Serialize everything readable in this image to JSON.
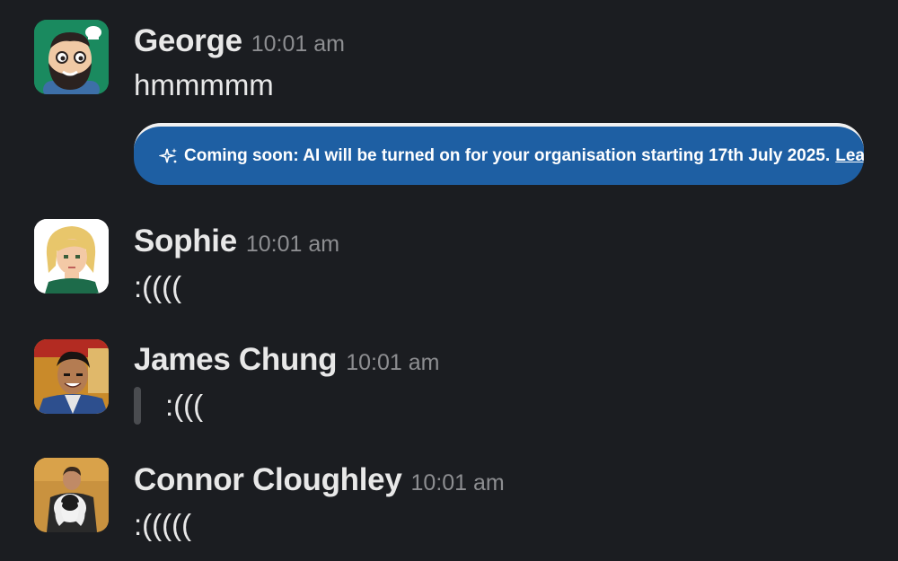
{
  "messages": [
    {
      "sender": "George",
      "time": "10:01 am",
      "text": "hmmmmm",
      "avatar_icon": "cartoon-bearded-chef-avatar"
    },
    {
      "sender": "Sophie",
      "time": "10:01 am",
      "text": ":((((",
      "avatar_icon": "pixel-art-blonde-woman-avatar"
    },
    {
      "sender": "James Chung",
      "time": "10:01 am",
      "text": ":(((",
      "avatar_icon": "photo-smiling-man-avatar"
    },
    {
      "sender": "Connor Cloughley",
      "time": "10:01 am",
      "text": ":(((((",
      "avatar_icon": "photo-man-with-dog-avatar"
    }
  ],
  "banner": {
    "text": "Coming soon: AI will be turned on for your organisation starting 17th July 2025.",
    "link": "Learn more",
    "icon": "sparkle-icon",
    "color": "#1e5fa3"
  },
  "colors": {
    "background": "#1b1d21",
    "name": "#e8e8e8",
    "timestamp": "#8d8e91"
  }
}
